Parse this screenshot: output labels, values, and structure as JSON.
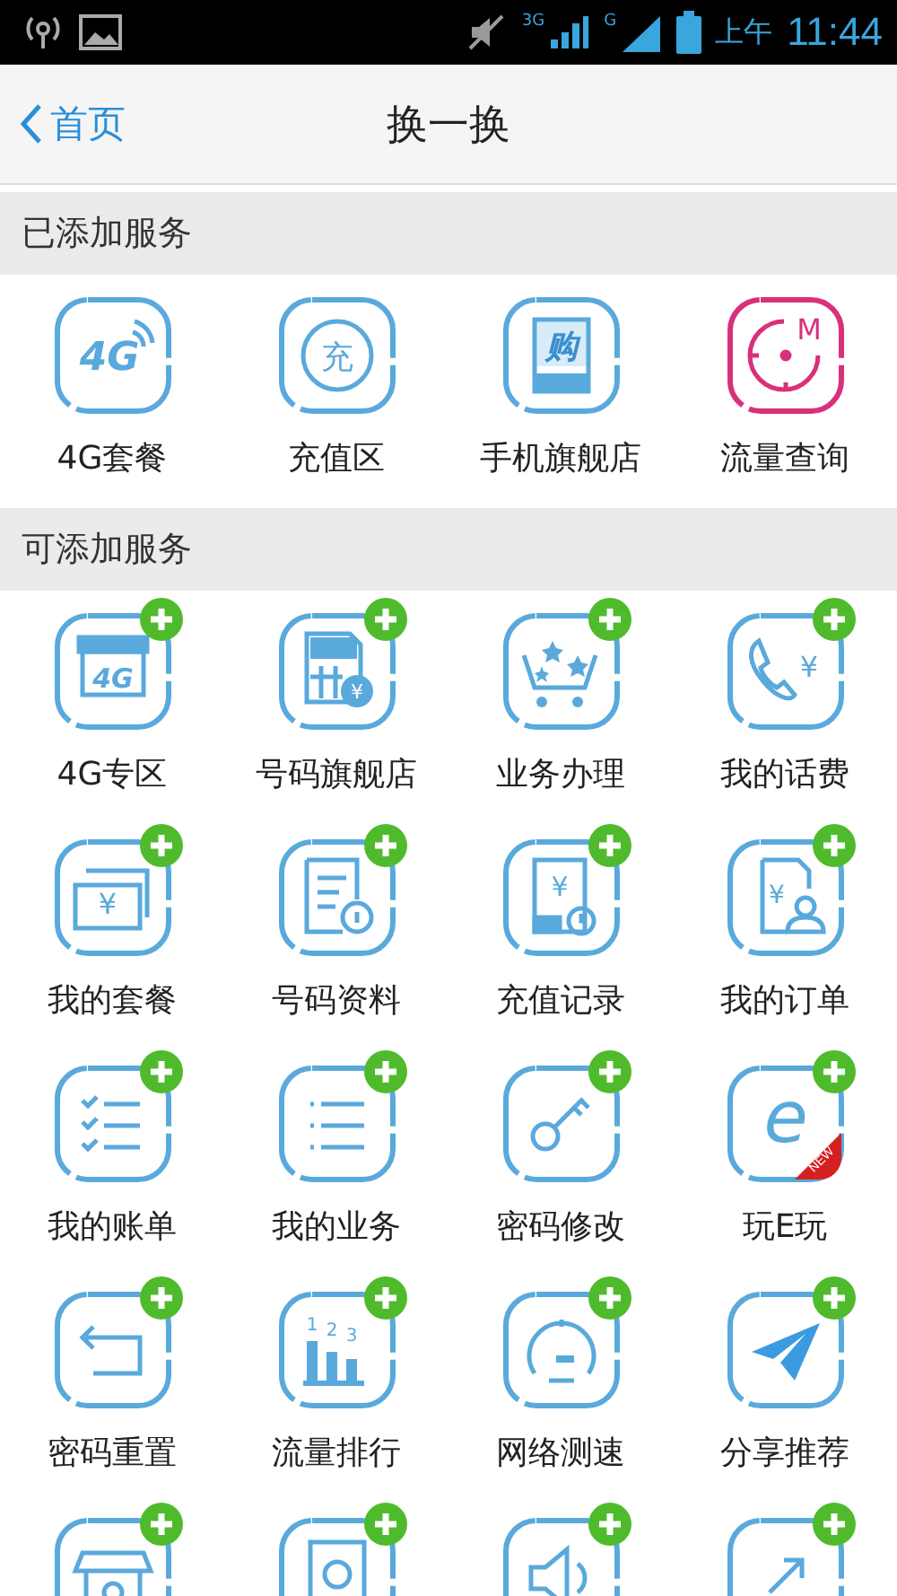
{
  "status_bar": {
    "network_label": "3G",
    "signal_label": "G",
    "time_prefix": "上午",
    "time": "11:44"
  },
  "header": {
    "back_label": "首页",
    "title": "换一换"
  },
  "sections": [
    {
      "title": "已添加服务",
      "kind": "added",
      "items": [
        {
          "label": "4G套餐",
          "kind": "signal",
          "glyph": "4G"
        },
        {
          "label": "充值区",
          "kind": "charge",
          "glyph": "充"
        },
        {
          "label": "手机旗舰店",
          "kind": "tablet",
          "glyph": "购"
        },
        {
          "label": "流量查询",
          "kind": "clock",
          "glyph": "M"
        }
      ]
    },
    {
      "title": "可添加服务",
      "kind": "addable",
      "items": [
        {
          "label": "4G专区",
          "kind": "store",
          "glyph": "4G"
        },
        {
          "label": "号码旗舰店",
          "kind": "sim",
          "glyph": "¥"
        },
        {
          "label": "业务办理",
          "kind": "cart"
        },
        {
          "label": "我的话费",
          "kind": "phone",
          "glyph": "¥"
        },
        {
          "label": "我的套餐",
          "kind": "card",
          "glyph": "¥"
        },
        {
          "label": "号码资料",
          "kind": "doc"
        },
        {
          "label": "充值记录",
          "kind": "record",
          "glyph": "¥"
        },
        {
          "label": "我的订单",
          "kind": "order",
          "glyph": "¥"
        },
        {
          "label": "我的账单",
          "kind": "checklist"
        },
        {
          "label": "我的业务",
          "kind": "list"
        },
        {
          "label": "密码修改",
          "kind": "key"
        },
        {
          "label": "玩E玩",
          "kind": "enew",
          "glyph": "e",
          "ribbon": "NEW"
        },
        {
          "label": "密码重置",
          "kind": "return"
        },
        {
          "label": "流量排行",
          "kind": "rank",
          "glyph": "1 2 3"
        },
        {
          "label": "网络测速",
          "kind": "speed"
        },
        {
          "label": "分享推荐",
          "kind": "plane"
        },
        {
          "kind": "shop"
        },
        {
          "kind": "photo"
        },
        {
          "kind": "speaker"
        },
        {
          "kind": "arrow"
        }
      ]
    }
  ]
}
